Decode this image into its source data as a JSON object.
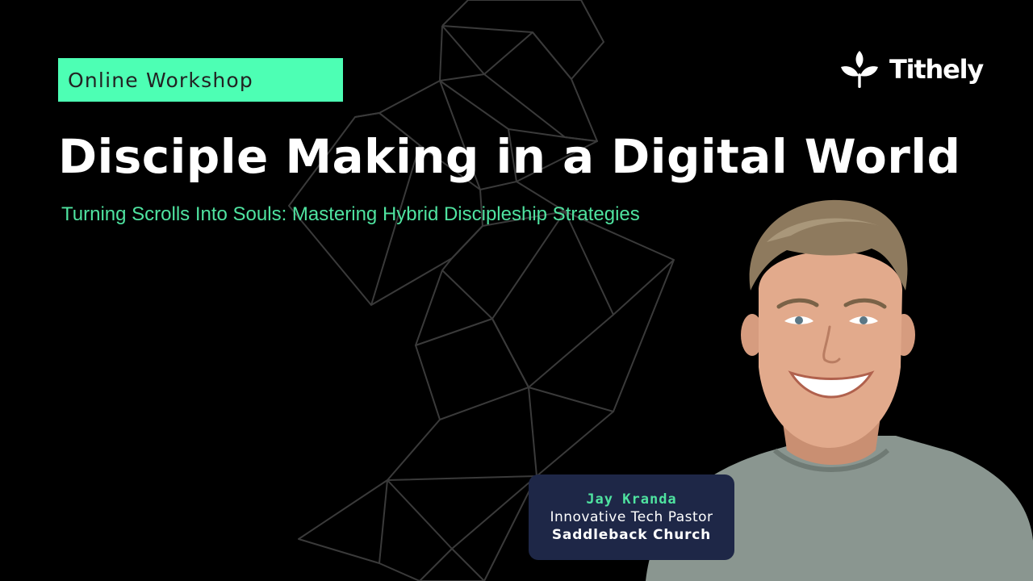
{
  "badge": {
    "label": "Online Workshop"
  },
  "brand": {
    "name": "Tithely",
    "icon": "leaf-sprout-icon"
  },
  "title": "Disciple Making in a Digital World",
  "subtitle": "Turning Scrolls Into Souls: Mastering Hybrid Discipleship Strategies",
  "speaker": {
    "name": "Jay Kranda",
    "role": "Innovative Tech Pastor",
    "organization": "Saddleback Church"
  },
  "colors": {
    "background": "#000000",
    "accent": "#4dffb4",
    "subtitle": "#4fe3a0",
    "card": "#1e2747"
  }
}
